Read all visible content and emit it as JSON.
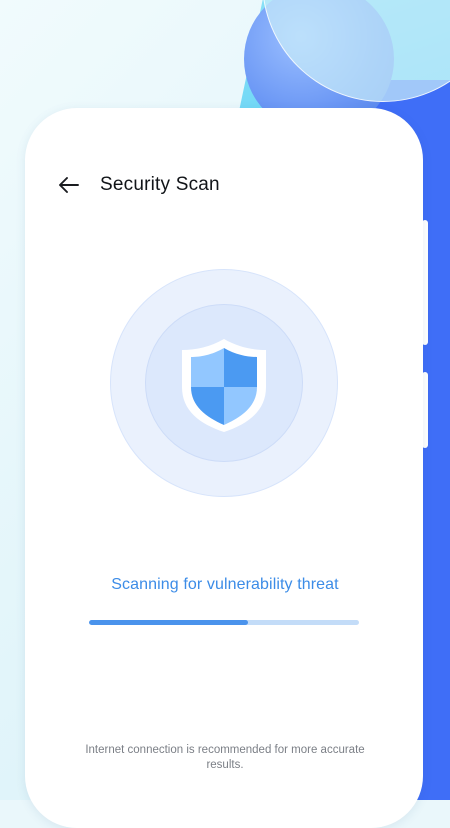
{
  "header": {
    "title": "Security Scan",
    "back_icon": "arrow-left-icon"
  },
  "scan": {
    "icon": "shield-icon",
    "status_text": "Scanning for vulnerability threat",
    "progress": 0.59
  },
  "footer": {
    "note": "Internet connection is recommended for more accurate results."
  },
  "colors": {
    "accent": "#3c8ce7",
    "progress_fill": "#4a93ec",
    "progress_track": "#c3dcf8",
    "background_blue": "#3f6ef7",
    "shield_light": "#8ec4ff",
    "shield_dark": "#4a98f0"
  }
}
